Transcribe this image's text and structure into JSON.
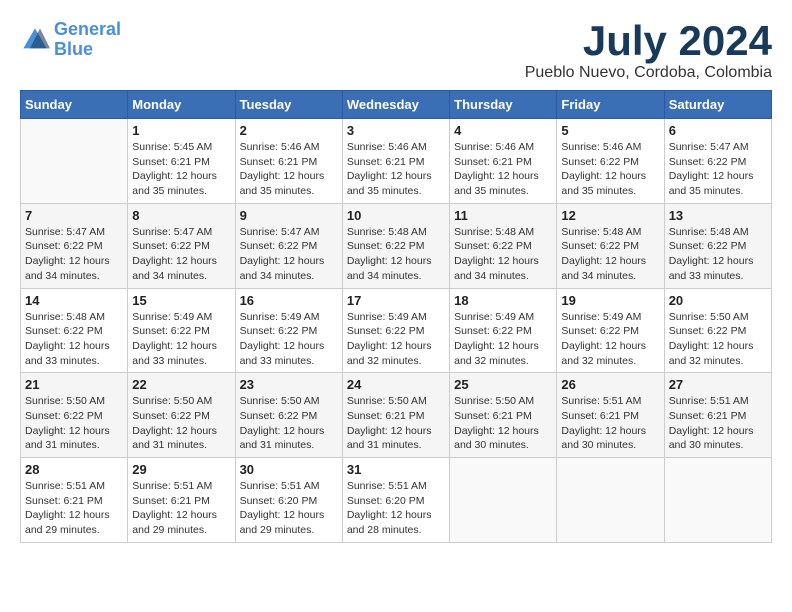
{
  "header": {
    "logo_line1": "General",
    "logo_line2": "Blue",
    "month": "July 2024",
    "location": "Pueblo Nuevo, Cordoba, Colombia"
  },
  "days_of_week": [
    "Sunday",
    "Monday",
    "Tuesday",
    "Wednesday",
    "Thursday",
    "Friday",
    "Saturday"
  ],
  "weeks": [
    [
      {
        "day": "",
        "info": ""
      },
      {
        "day": "1",
        "info": "Sunrise: 5:45 AM\nSunset: 6:21 PM\nDaylight: 12 hours\nand 35 minutes."
      },
      {
        "day": "2",
        "info": "Sunrise: 5:46 AM\nSunset: 6:21 PM\nDaylight: 12 hours\nand 35 minutes."
      },
      {
        "day": "3",
        "info": "Sunrise: 5:46 AM\nSunset: 6:21 PM\nDaylight: 12 hours\nand 35 minutes."
      },
      {
        "day": "4",
        "info": "Sunrise: 5:46 AM\nSunset: 6:21 PM\nDaylight: 12 hours\nand 35 minutes."
      },
      {
        "day": "5",
        "info": "Sunrise: 5:46 AM\nSunset: 6:22 PM\nDaylight: 12 hours\nand 35 minutes."
      },
      {
        "day": "6",
        "info": "Sunrise: 5:47 AM\nSunset: 6:22 PM\nDaylight: 12 hours\nand 35 minutes."
      }
    ],
    [
      {
        "day": "7",
        "info": "Sunrise: 5:47 AM\nSunset: 6:22 PM\nDaylight: 12 hours\nand 34 minutes."
      },
      {
        "day": "8",
        "info": "Sunrise: 5:47 AM\nSunset: 6:22 PM\nDaylight: 12 hours\nand 34 minutes."
      },
      {
        "day": "9",
        "info": "Sunrise: 5:47 AM\nSunset: 6:22 PM\nDaylight: 12 hours\nand 34 minutes."
      },
      {
        "day": "10",
        "info": "Sunrise: 5:48 AM\nSunset: 6:22 PM\nDaylight: 12 hours\nand 34 minutes."
      },
      {
        "day": "11",
        "info": "Sunrise: 5:48 AM\nSunset: 6:22 PM\nDaylight: 12 hours\nand 34 minutes."
      },
      {
        "day": "12",
        "info": "Sunrise: 5:48 AM\nSunset: 6:22 PM\nDaylight: 12 hours\nand 34 minutes."
      },
      {
        "day": "13",
        "info": "Sunrise: 5:48 AM\nSunset: 6:22 PM\nDaylight: 12 hours\nand 33 minutes."
      }
    ],
    [
      {
        "day": "14",
        "info": "Sunrise: 5:48 AM\nSunset: 6:22 PM\nDaylight: 12 hours\nand 33 minutes."
      },
      {
        "day": "15",
        "info": "Sunrise: 5:49 AM\nSunset: 6:22 PM\nDaylight: 12 hours\nand 33 minutes."
      },
      {
        "day": "16",
        "info": "Sunrise: 5:49 AM\nSunset: 6:22 PM\nDaylight: 12 hours\nand 33 minutes."
      },
      {
        "day": "17",
        "info": "Sunrise: 5:49 AM\nSunset: 6:22 PM\nDaylight: 12 hours\nand 32 minutes."
      },
      {
        "day": "18",
        "info": "Sunrise: 5:49 AM\nSunset: 6:22 PM\nDaylight: 12 hours\nand 32 minutes."
      },
      {
        "day": "19",
        "info": "Sunrise: 5:49 AM\nSunset: 6:22 PM\nDaylight: 12 hours\nand 32 minutes."
      },
      {
        "day": "20",
        "info": "Sunrise: 5:50 AM\nSunset: 6:22 PM\nDaylight: 12 hours\nand 32 minutes."
      }
    ],
    [
      {
        "day": "21",
        "info": "Sunrise: 5:50 AM\nSunset: 6:22 PM\nDaylight: 12 hours\nand 31 minutes."
      },
      {
        "day": "22",
        "info": "Sunrise: 5:50 AM\nSunset: 6:22 PM\nDaylight: 12 hours\nand 31 minutes."
      },
      {
        "day": "23",
        "info": "Sunrise: 5:50 AM\nSunset: 6:22 PM\nDaylight: 12 hours\nand 31 minutes."
      },
      {
        "day": "24",
        "info": "Sunrise: 5:50 AM\nSunset: 6:21 PM\nDaylight: 12 hours\nand 31 minutes."
      },
      {
        "day": "25",
        "info": "Sunrise: 5:50 AM\nSunset: 6:21 PM\nDaylight: 12 hours\nand 30 minutes."
      },
      {
        "day": "26",
        "info": "Sunrise: 5:51 AM\nSunset: 6:21 PM\nDaylight: 12 hours\nand 30 minutes."
      },
      {
        "day": "27",
        "info": "Sunrise: 5:51 AM\nSunset: 6:21 PM\nDaylight: 12 hours\nand 30 minutes."
      }
    ],
    [
      {
        "day": "28",
        "info": "Sunrise: 5:51 AM\nSunset: 6:21 PM\nDaylight: 12 hours\nand 29 minutes."
      },
      {
        "day": "29",
        "info": "Sunrise: 5:51 AM\nSunset: 6:21 PM\nDaylight: 12 hours\nand 29 minutes."
      },
      {
        "day": "30",
        "info": "Sunrise: 5:51 AM\nSunset: 6:20 PM\nDaylight: 12 hours\nand 29 minutes."
      },
      {
        "day": "31",
        "info": "Sunrise: 5:51 AM\nSunset: 6:20 PM\nDaylight: 12 hours\nand 28 minutes."
      },
      {
        "day": "",
        "info": ""
      },
      {
        "day": "",
        "info": ""
      },
      {
        "day": "",
        "info": ""
      }
    ]
  ]
}
